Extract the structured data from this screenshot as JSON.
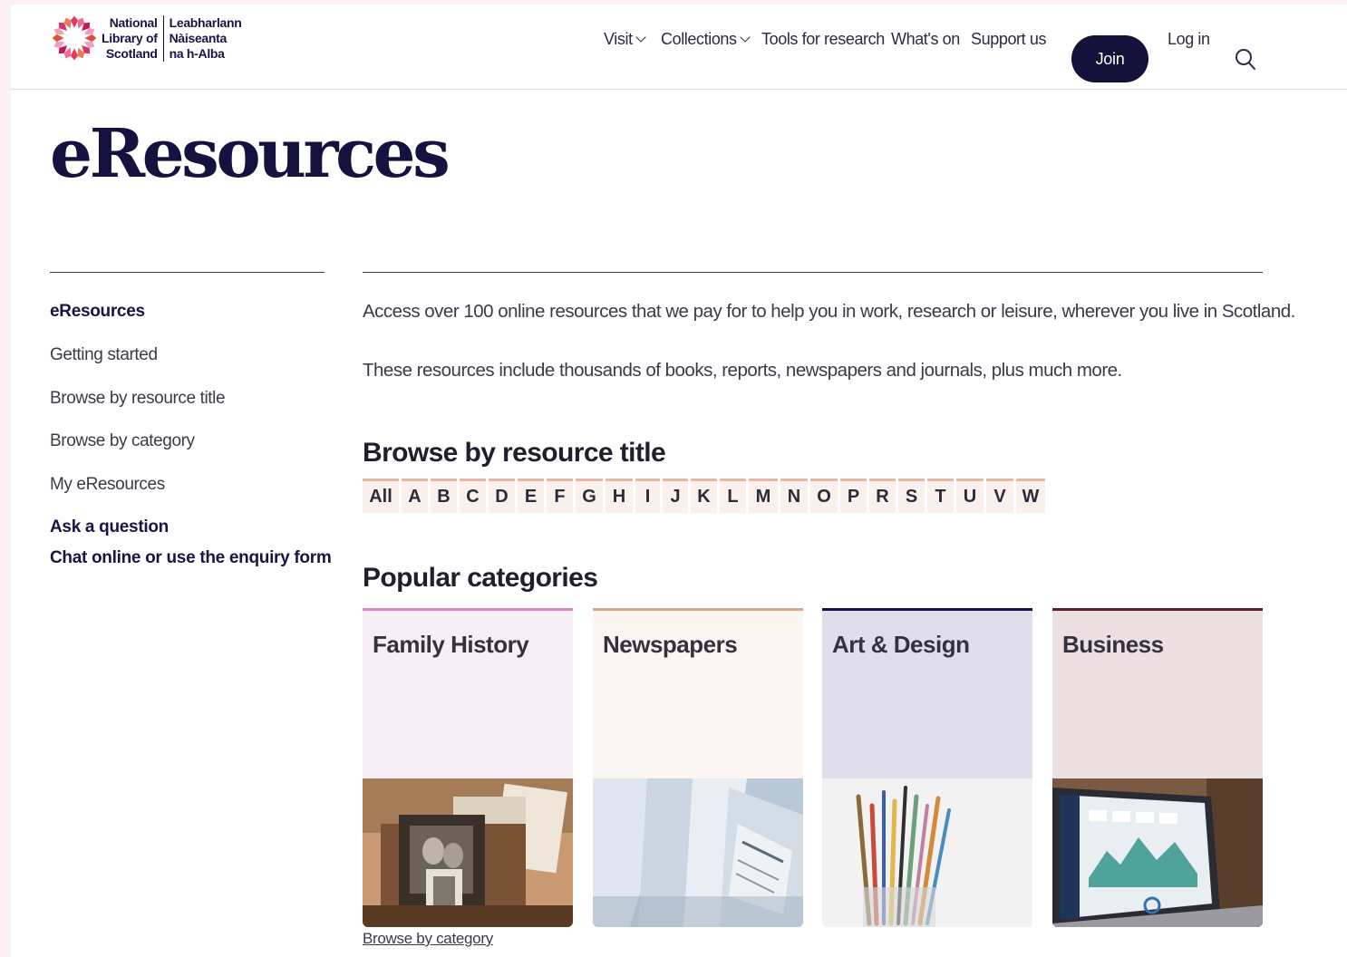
{
  "logo": {
    "english_lines": [
      "National",
      "Library of",
      "Scotland"
    ],
    "gaelic_lines": [
      "Leabharlann",
      "Nàiseanta",
      "na h-Alba"
    ]
  },
  "nav": {
    "visit": "Visit",
    "collections": "Collections",
    "tools": "Tools for research",
    "whats_on": "What's on",
    "support": "Support us",
    "join": "Join",
    "login": "Log in"
  },
  "page": {
    "title": "eResources"
  },
  "sidebar": {
    "items": [
      "eResources",
      "Getting started",
      "Browse by resource title",
      "Browse by category",
      "My eResources"
    ],
    "ask_heading": "Ask a question",
    "ask_link": "Chat online or use the enquiry form"
  },
  "main": {
    "intro1": "Access over 100 online resources that we pay for to help you in work, research or leisure, wherever you live in Scotland.",
    "intro2": "These resources include thousands of books, reports, newspapers and journals, plus much more.",
    "browse_title": "Browse by resource title",
    "letters": [
      "All",
      "A",
      "B",
      "C",
      "D",
      "E",
      "F",
      "G",
      "H",
      "I",
      "J",
      "K",
      "L",
      "M",
      "N",
      "O",
      "P",
      "R",
      "S",
      "T",
      "U",
      "V",
      "W"
    ],
    "popular_title": "Popular categories",
    "categories": [
      {
        "title": "Family History",
        "color": "#f8eef6",
        "accent": "#d985c0"
      },
      {
        "title": "Newspapers",
        "color": "#fcf6f3",
        "accent": "#dba58e"
      },
      {
        "title": "Art & Design",
        "color": "#e0dfe9",
        "accent": "#17144a"
      },
      {
        "title": "Business",
        "color": "#ece0e3",
        "accent": "#5c1f2e"
      }
    ],
    "browse_category_link": "Browse by category"
  },
  "colors": {
    "brand_navy": "#14113b",
    "letter_bg": "#fbf1ec",
    "letter_border": "#e3b7a3"
  }
}
